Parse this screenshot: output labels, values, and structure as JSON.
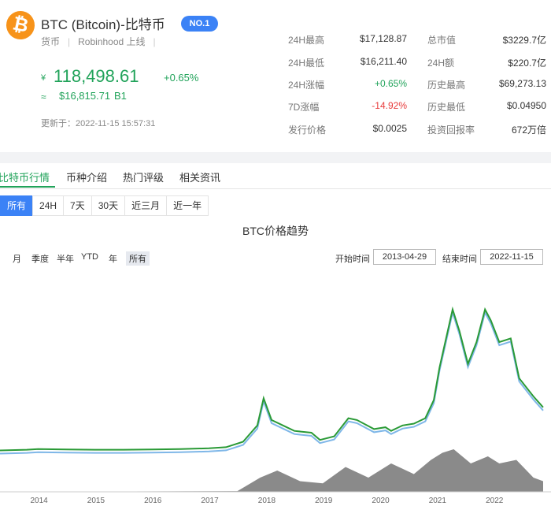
{
  "coin": {
    "logo_glyph": "₿",
    "name": "BTC (Bitcoin)-比特币",
    "rank_badge": "NO.1",
    "category": "货币",
    "listing": "Robinhood 上线",
    "cny_symbol": "¥",
    "price_cny": "118,498.61",
    "change_pct": "+0.65%",
    "approx_symbol": "≈",
    "price_usd": "$16,815.71",
    "unit": "B1",
    "updated": "更新于：2022-11-15 15:57:31"
  },
  "stats": [
    {
      "label": "24H最高",
      "value": "$17,128.87",
      "color": "#333333"
    },
    {
      "label": "24H最低",
      "value": "$16,211.40",
      "color": "#333333"
    },
    {
      "label": "24H涨幅",
      "value": "+0.65%",
      "color": "#21a35a"
    },
    {
      "label": "7D涨幅",
      "value": "-14.92%",
      "color": "#e83b3b"
    },
    {
      "label": "发行价格",
      "value": "$0.0025",
      "color": "#333333"
    }
  ],
  "stats2": [
    {
      "label": "总市值",
      "value": "$3229.7亿"
    },
    {
      "label": "24H额",
      "value": "$220.7亿"
    },
    {
      "label": "历史最高",
      "value": "$69,273.13"
    },
    {
      "label": "历史最低",
      "value": "$0.04950"
    },
    {
      "label": "投资回报率",
      "value": "672万倍"
    }
  ],
  "tabs": [
    "比特币行情",
    "币种介绍",
    "热门评级",
    "相关资讯"
  ],
  "ranges": [
    "所有",
    "24H",
    "7天",
    "30天",
    "近三月",
    "近一年"
  ],
  "chart": {
    "title": "BTC价格趋势",
    "zoom": [
      "月",
      "季度",
      "半年",
      "YTD",
      "年",
      "所有"
    ],
    "start_label": "开始时间",
    "start_date": "2013-04-29",
    "end_label": "结束时间",
    "end_date": "2022-11-15"
  },
  "colors": {
    "accent": "#21a35a",
    "badge": "#3b82f6",
    "price_line": "#2a9a36",
    "ref_line": "#f0a020",
    "volume": "#8a8a8a",
    "shadow_line": "#7fb7e8"
  },
  "chart_data": {
    "type": "line",
    "x_ticks": [
      "2014",
      "2015",
      "2016",
      "2017",
      "2018",
      "2019",
      "2020",
      "2021",
      "2022"
    ],
    "series": [
      {
        "type": "line",
        "x": [
          2013.33,
          2013.8,
          2014.0,
          2014.5,
          2015.0,
          2015.5,
          2016.0,
          2016.5,
          2017.0,
          2017.3,
          2017.6,
          2017.85,
          2017.96,
          2018.1,
          2018.3,
          2018.5,
          2018.8,
          2018.95,
          2019.2,
          2019.45,
          2019.6,
          2019.9,
          2020.1,
          2020.2,
          2020.4,
          2020.6,
          2020.8,
          2020.95,
          2021.05,
          2021.28,
          2021.4,
          2021.55,
          2021.7,
          2021.85,
          2021.95,
          2022.1,
          2022.3,
          2022.45,
          2022.7,
          2022.87
        ],
        "y": [
          1,
          3,
          5,
          4,
          3,
          3,
          4,
          5,
          7,
          10,
          25,
          70,
          145,
          85,
          70,
          55,
          50,
          30,
          40,
          90,
          85,
          60,
          65,
          55,
          70,
          75,
          90,
          140,
          230,
          390,
          330,
          240,
          300,
          390,
          360,
          300,
          310,
          200,
          150,
          120
        ]
      },
      {
        "type": "line",
        "x": [
          2013.33,
          2017.85,
          2017.93,
          2017.96,
          2017.99,
          2018.02,
          2018.05,
          2022.87
        ],
        "y": [
          360,
          360,
          380,
          565,
          470,
          360,
          370,
          360
        ]
      },
      {
        "type": "area",
        "x": [
          2013.33,
          2017.5,
          2017.9,
          2018.2,
          2018.6,
          2019.0,
          2019.4,
          2019.8,
          2020.2,
          2020.6,
          2020.9,
          2021.1,
          2021.3,
          2021.6,
          2021.9,
          2022.1,
          2022.4,
          2022.7,
          2022.87
        ],
        "y": [
          0,
          1,
          20,
          30,
          15,
          12,
          35,
          20,
          40,
          25,
          45,
          55,
          60,
          40,
          50,
          40,
          45,
          20,
          15
        ]
      }
    ]
  }
}
